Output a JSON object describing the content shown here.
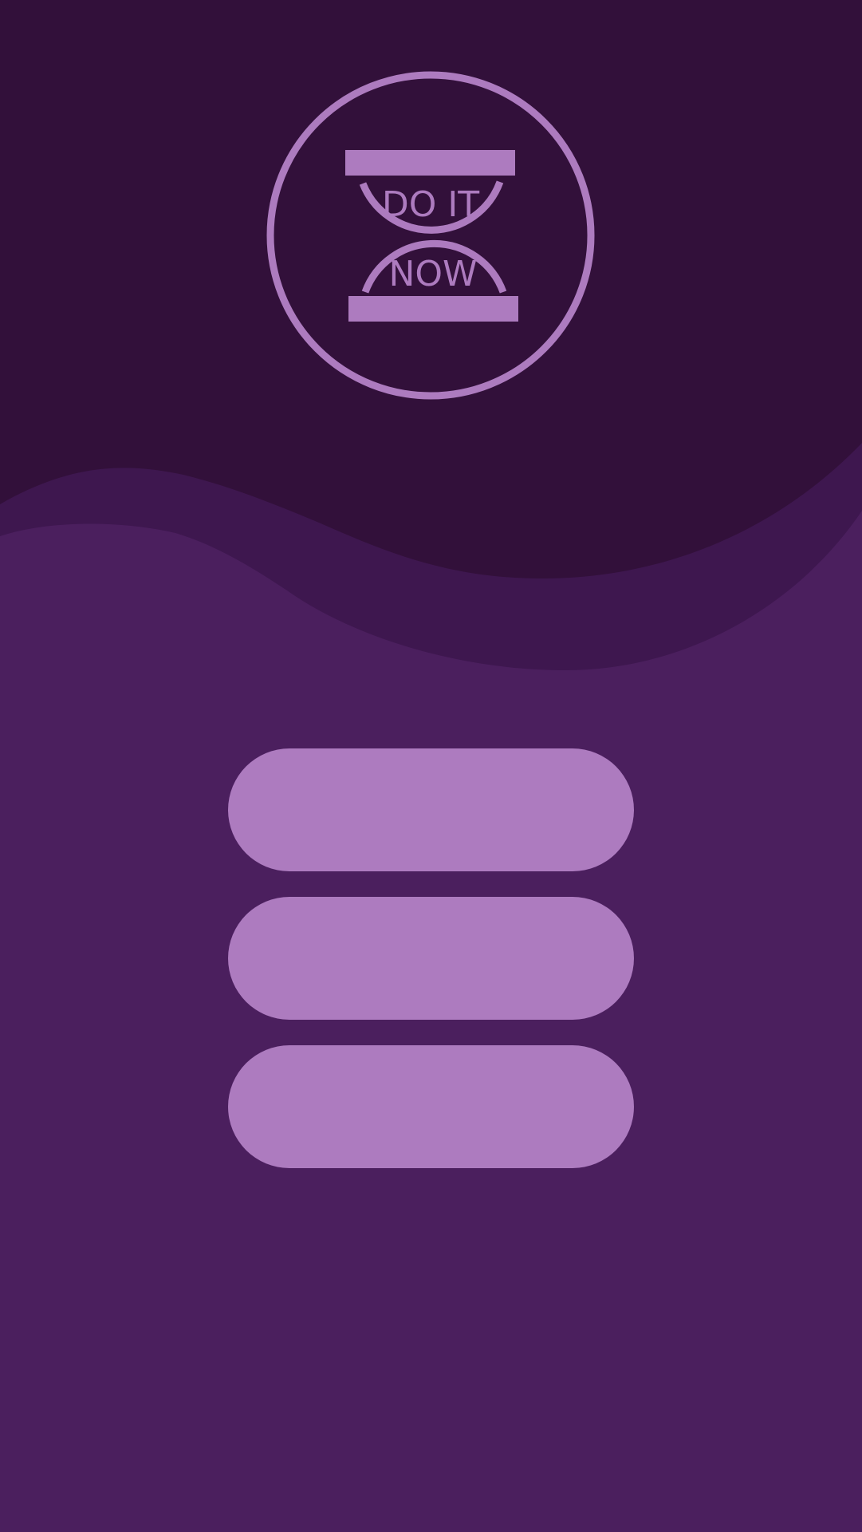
{
  "colors": {
    "header_dark": "#32103a",
    "wave_mid": "#3e174f",
    "body_purple": "#4b1f5e",
    "accent_lilac": "#ad7bbf"
  },
  "logo": {
    "icon": "hourglass-icon",
    "line1": "DO IT",
    "line2": "NOW"
  },
  "menu": {
    "buttons": [
      {
        "label": ""
      },
      {
        "label": ""
      },
      {
        "label": ""
      }
    ]
  }
}
